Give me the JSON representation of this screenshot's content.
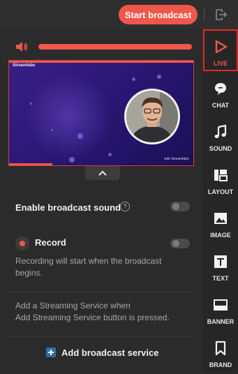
{
  "header": {
    "start_label": "Start broadcast"
  },
  "preview": {
    "logo_text": "Streamlabs",
    "watermark_text": "with Streamlabs"
  },
  "settings": {
    "broadcast_sound_label": "Enable broadcast sound",
    "help_glyph": "?",
    "record_label": "Record",
    "record_desc_line1": "Recording will start when the broadcast",
    "record_desc_line2": "begins.",
    "service_desc_line1": "Add a Streaming Service when",
    "service_desc_line2": "Add Streaming Service button is pressed.",
    "add_service_label": "Add broadcast service",
    "volume_level": 1.0
  },
  "sidebar": {
    "items": [
      {
        "label": "LIVE",
        "icon": "play-icon",
        "active": true
      },
      {
        "label": "CHAT",
        "icon": "chat-bubble-icon"
      },
      {
        "label": "SOUND",
        "icon": "music-note-icon"
      },
      {
        "label": "LAYOUT",
        "icon": "layout-icon"
      },
      {
        "label": "IMAGE",
        "icon": "image-icon"
      },
      {
        "label": "TEXT",
        "icon": "text-icon"
      },
      {
        "label": "BANNER",
        "icon": "banner-icon"
      },
      {
        "label": "BRAND",
        "icon": "bookmark-icon"
      }
    ]
  },
  "colors": {
    "accent": "#f0574a",
    "active_outline": "#e02a2a",
    "panel_bg": "#2b2b2b",
    "sidebar_bg": "#262626"
  }
}
